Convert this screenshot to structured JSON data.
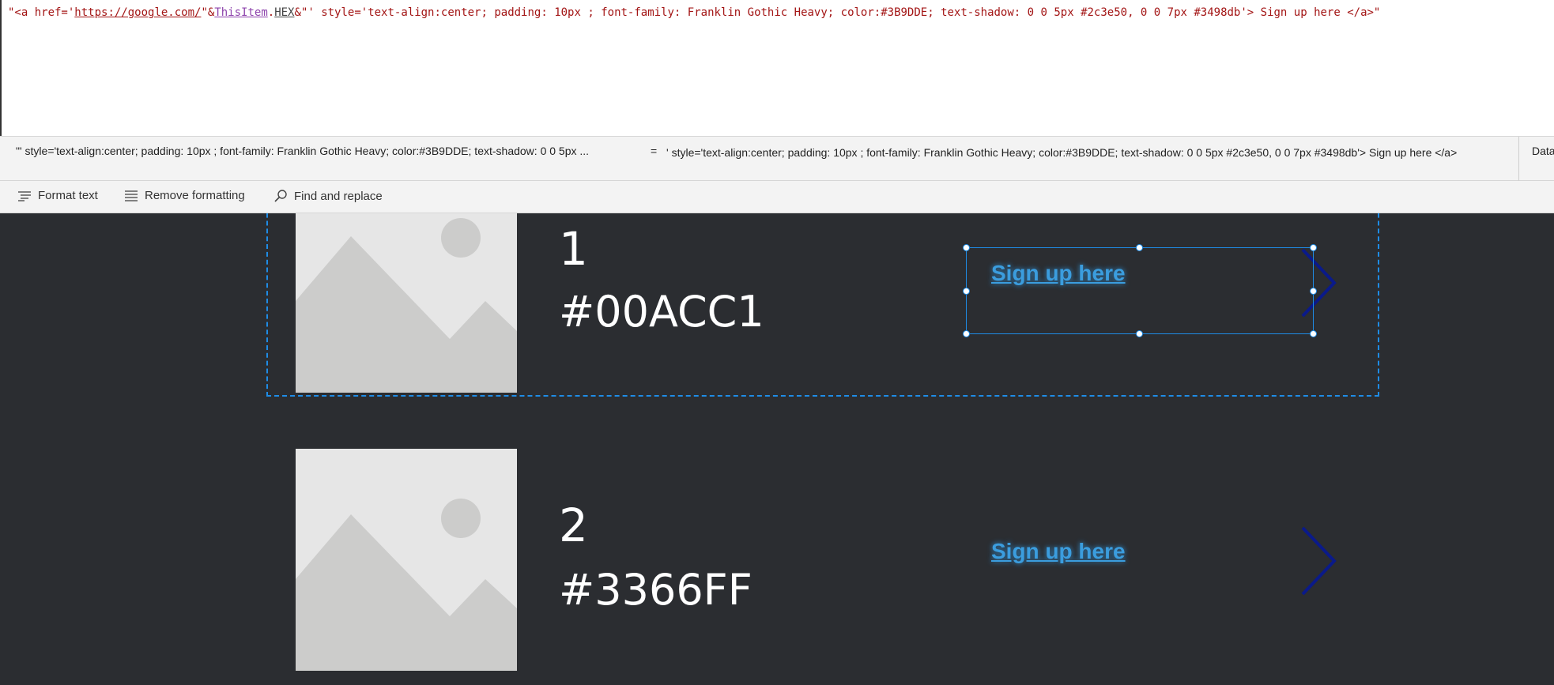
{
  "formula": {
    "part1": "\"<a href='",
    "link": "https://google.com/",
    "part2": "\"&",
    "ident": "ThisItem",
    "dot": ".",
    "prop": "HEX",
    "part3": "&\"' style='text-align:center; padding: 10px ; font-family: Franklin Gothic Heavy; color:#3B9DDE; text-shadow: 0 0 5px #2c3e50, 0 0 7px #3498db'> Sign up here  </a>\""
  },
  "result": {
    "expression": "\"' style='text-align:center; padding: 10px ; font-family: Franklin Gothic Heavy; color:#3B9DDE; text-shadow: 0 0 5px ...",
    "equals": "=",
    "value": "' style='text-align:center; padding: 10px ; font-family: Franklin Gothic Heavy; color:#3B9DDE; text-shadow: 0 0 5px #2c3e50, 0 0 7px #3498db'> Sign up here </a>",
    "data_type": "Data"
  },
  "toolbar": {
    "format_text": "Format text",
    "remove_formatting": "Remove formatting",
    "find_replace": "Find and replace"
  },
  "gallery": {
    "items": [
      {
        "number": "1",
        "hex": "#00ACC1",
        "link_text": "Sign up here"
      },
      {
        "number": "2",
        "hex": "#3366FF",
        "link_text": "Sign up here"
      }
    ]
  },
  "colors": {
    "link": "#3B9DDE",
    "selection": "#1e8ce6",
    "chevron": "#0a1a8a",
    "background": "#2b2d31"
  },
  "icons": [
    "format-text-icon",
    "remove-formatting-icon",
    "find-replace-icon",
    "image-placeholder-icon",
    "chevron-right-icon"
  ]
}
